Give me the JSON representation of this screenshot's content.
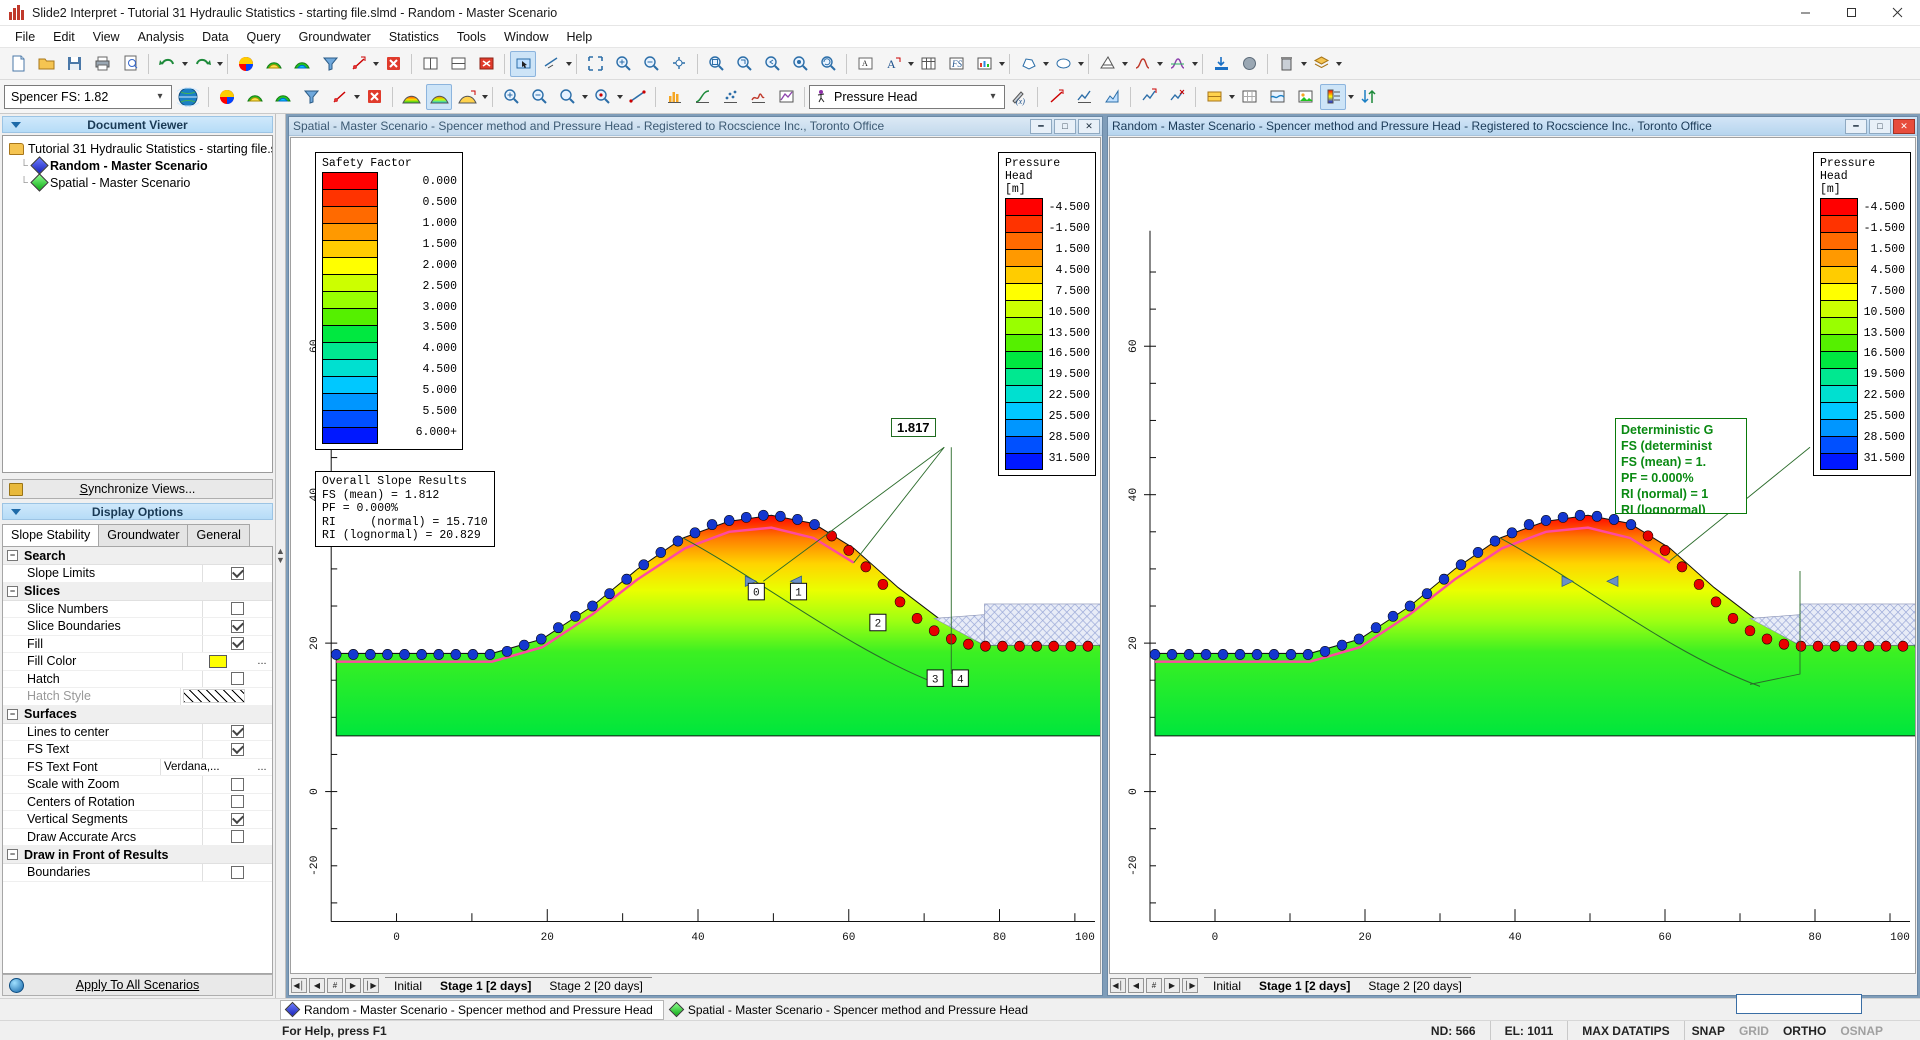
{
  "window": {
    "title": "Slide2 Interpret - Tutorial 31 Hydraulic Statistics - starting file.slmd - Random - Master Scenario",
    "minimize": "–",
    "maximize": "☐",
    "close": "✕"
  },
  "menu": [
    "File",
    "Edit",
    "View",
    "Analysis",
    "Data",
    "Query",
    "Groundwater",
    "Statistics",
    "Tools",
    "Window",
    "Help"
  ],
  "toolbar2": {
    "fs_combo_value": "Spencer FS: 1.82",
    "ph_combo_value": "Pressure Head"
  },
  "document_viewer": {
    "header": "Document Viewer",
    "root": "Tutorial 31 Hydraulic Statistics - starting file.slmd",
    "items": [
      {
        "label": "Random - Master Scenario",
        "color": "blue",
        "selected": true
      },
      {
        "label": "Spatial - Master Scenario",
        "color": "green",
        "selected": false
      }
    ],
    "sync_button": "Synchronize Views..."
  },
  "display_options": {
    "header": "Display Options",
    "tabs": [
      "Slope Stability",
      "Groundwater",
      "General"
    ],
    "selected_tab": "Slope Stability",
    "groups": [
      {
        "name": "Search",
        "rows": [
          {
            "label": "Slope Limits",
            "type": "check",
            "value": true
          }
        ]
      },
      {
        "name": "Slices",
        "rows": [
          {
            "label": "Slice Numbers",
            "type": "check",
            "value": false
          },
          {
            "label": "Slice Boundaries",
            "type": "check",
            "value": true
          },
          {
            "label": "Fill",
            "type": "check",
            "value": true
          },
          {
            "label": "Fill Color",
            "type": "color",
            "value": "#ffff00",
            "ext": "..."
          },
          {
            "label": "Hatch",
            "type": "check",
            "value": false
          },
          {
            "label": "Hatch Style",
            "type": "hatch",
            "value": "",
            "disabled": true
          }
        ]
      },
      {
        "name": "Surfaces",
        "rows": [
          {
            "label": "Lines to center",
            "type": "check",
            "value": true
          },
          {
            "label": "FS Text",
            "type": "check",
            "value": true
          },
          {
            "label": "FS Text Font",
            "type": "text",
            "value": "Verdana,...",
            "ext": "..."
          },
          {
            "label": "Scale with Zoom",
            "type": "check",
            "value": false
          },
          {
            "label": "Centers of Rotation",
            "type": "check",
            "value": false
          },
          {
            "label": "Vertical Segments",
            "type": "check",
            "value": true
          },
          {
            "label": "Draw Accurate Arcs",
            "type": "check",
            "value": false
          }
        ]
      },
      {
        "name": "Draw in Front of Results",
        "rows": [
          {
            "label": "Boundaries",
            "type": "check",
            "value": false
          }
        ]
      }
    ],
    "apply_button": "Apply To All Scenarios"
  },
  "windows": [
    {
      "id": "spatial",
      "title": "Spatial - Master Scenario - Spencer method and Pressure Head - Registered to Rocscience Inc., Toronto Office",
      "active": false,
      "stage_tabs": [
        "Initial",
        "Stage 1 [2 days]",
        "Stage 2 [20 days]"
      ],
      "selected_stage": "Stage 1 [2 days]",
      "fs_label": "1.817",
      "result_box": "Overall Slope Results\nFS (mean) = 1.812\nPF = 0.000%\nRI     (normal) = 15.710\nRI (lognormal) = 20.829",
      "x_ticks": [
        "0",
        "20",
        "40",
        "60",
        "80",
        "100"
      ],
      "y_ticks": [
        "60",
        "40",
        "20",
        "0",
        "-20"
      ]
    },
    {
      "id": "random",
      "title": "Random - Master Scenario - Spencer method and Pressure Head - Registered to Rocscience Inc., Toronto Office",
      "active": true,
      "stage_tabs": [
        "Initial",
        "Stage 1 [2 days]",
        "Stage 2 [20 days]"
      ],
      "selected_stage": "Stage 1 [2 days]",
      "green_box": "Deterministic G\nFS (determinist\nFS (mean) = 1.\nPF = 0.000%\nRI (normal) = 1\nRI (lognormal)",
      "x_ticks": [
        "0",
        "20",
        "40",
        "60",
        "80",
        "100"
      ],
      "y_ticks": [
        "60",
        "40",
        "20",
        "0",
        "-20"
      ]
    }
  ],
  "chart_data": [
    {
      "type": "heatmap",
      "title": "Safety Factor",
      "legend_title": "Safety Factor",
      "legend_labels": [
        "0.000",
        "0.500",
        "1.000",
        "1.500",
        "2.000",
        "2.500",
        "3.000",
        "3.500",
        "4.000",
        "4.500",
        "5.000",
        "5.500",
        "6.000+"
      ],
      "legend_colors": [
        "#ff0000",
        "#ff3300",
        "#ff6a00",
        "#ff9900",
        "#ffcc00",
        "#ffff00",
        "#ccff00",
        "#99ff00",
        "#55f000",
        "#00e840",
        "#00e890",
        "#00e0d0",
        "#00c8ff",
        "#0096ff",
        "#0050ff",
        "#0018ff"
      ],
      "xlabel": "",
      "ylabel": "",
      "xlim": [
        -10,
        115
      ],
      "ylim": [
        -30,
        70
      ],
      "x_ticks": [
        0,
        20,
        40,
        60,
        80,
        100
      ],
      "y_ticks": [
        -20,
        0,
        20,
        40,
        60
      ],
      "grid": false
    },
    {
      "type": "heatmap",
      "title": "Pressure Head",
      "legend_title": "Pressure Head",
      "legend_units": "[m]",
      "legend_labels": [
        "-4.500",
        "-1.500",
        "1.500",
        "4.500",
        "7.500",
        "10.500",
        "13.500",
        "16.500",
        "19.500",
        "22.500",
        "25.500",
        "28.500",
        "31.500"
      ],
      "legend_colors": [
        "#ff0000",
        "#ff3300",
        "#ff6a00",
        "#ff9900",
        "#ffcc00",
        "#ffff00",
        "#ccff00",
        "#99ff00",
        "#55f000",
        "#00e840",
        "#00e890",
        "#00e0d0",
        "#00c8ff",
        "#0096ff",
        "#0050ff",
        "#0018ff"
      ],
      "xlabel": "",
      "ylabel": "",
      "xlim": [
        -10,
        115
      ],
      "ylim": [
        -30,
        70
      ],
      "x_ticks": [
        0,
        20,
        40,
        60,
        80,
        100
      ],
      "y_ticks": [
        -20,
        0,
        20,
        40,
        60
      ],
      "grid": false
    }
  ],
  "bottom_tabs": [
    {
      "label": "Random - Master Scenario - Spencer method and Pressure Head",
      "color": "blue",
      "selected": true
    },
    {
      "label": "Spatial - Master Scenario - Spencer method and Pressure Head",
      "color": "green",
      "selected": false
    }
  ],
  "statusbar": {
    "help": "For Help, press F1",
    "nd": "ND: 566",
    "el": "EL: 1011",
    "maxdatatips": "MAX DATATIPS",
    "snap": "SNAP",
    "grid": "GRID",
    "ortho": "ORTHO",
    "osnap": "OSNAP"
  },
  "nav_buttons": [
    "◀│",
    "◀",
    "#",
    "▶",
    "│▶"
  ]
}
